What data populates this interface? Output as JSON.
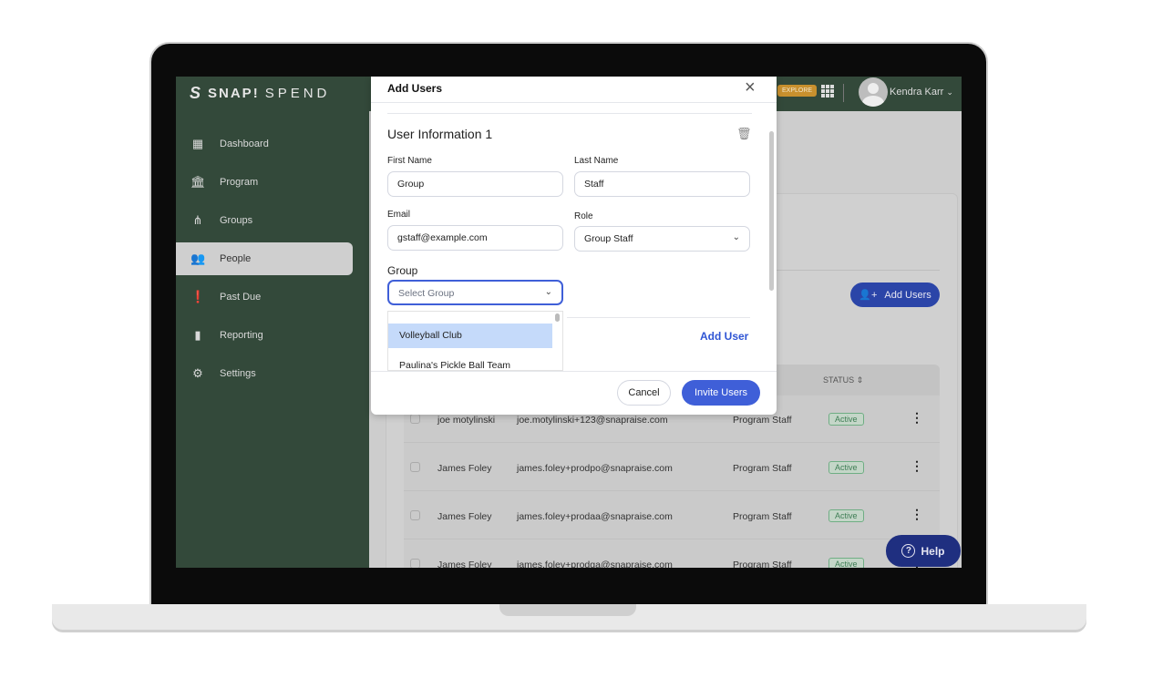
{
  "brand": {
    "logo_bold": "SNAP!",
    "logo_light": "SPEND"
  },
  "sidebar": {
    "items": [
      {
        "label": "Dashboard",
        "icon": "dashboard-icon"
      },
      {
        "label": "Program",
        "icon": "bank-icon"
      },
      {
        "label": "Groups",
        "icon": "hierarchy-icon"
      },
      {
        "label": "People",
        "icon": "people-icon",
        "active": true
      },
      {
        "label": "Past Due",
        "icon": "alert-doc-icon"
      },
      {
        "label": "Reporting",
        "icon": "bar-chart-icon"
      },
      {
        "label": "Settings",
        "icon": "gear-icon"
      }
    ]
  },
  "topbar": {
    "explore": "EXPLORE",
    "user_name": "Kendra Karr"
  },
  "main": {
    "add_users_label": "Add Users",
    "table": {
      "status_header": "STATUS",
      "rows": [
        {
          "name": "joe motylinski",
          "email": "joe.motylinski+123@snapraise.com",
          "role": "Program Staff",
          "status": "Active"
        },
        {
          "name": "James Foley",
          "email": "james.foley+prodpo@snapraise.com",
          "role": "Program Staff",
          "status": "Active"
        },
        {
          "name": "James Foley",
          "email": "james.foley+prodaa@snapraise.com",
          "role": "Program Staff",
          "status": "Active"
        },
        {
          "name": "James Foley",
          "email": "james.foley+prodga@snapraise.com",
          "role": "Program Staff",
          "status": "Active"
        }
      ]
    }
  },
  "help": {
    "label": "Help"
  },
  "modal": {
    "title": "Add Users",
    "section_title": "User Information 1",
    "first_name": {
      "label": "First Name",
      "value": "Group"
    },
    "last_name": {
      "label": "Last Name",
      "value": "Staff"
    },
    "email": {
      "label": "Email",
      "value": "gstaff@example.com"
    },
    "role": {
      "label": "Role",
      "value": "Group Staff"
    },
    "group": {
      "label": "Group",
      "placeholder": "Select Group",
      "options": [
        "Volleyball Club",
        "Paulina's Pickle Ball Team"
      ]
    },
    "add_user": "Add User",
    "cancel": "Cancel",
    "invite": "Invite Users"
  },
  "colors": {
    "sidebar": "#33493a",
    "primary": "#3f5fd8",
    "explore": "#c8902e",
    "help": "#1f2f80"
  }
}
